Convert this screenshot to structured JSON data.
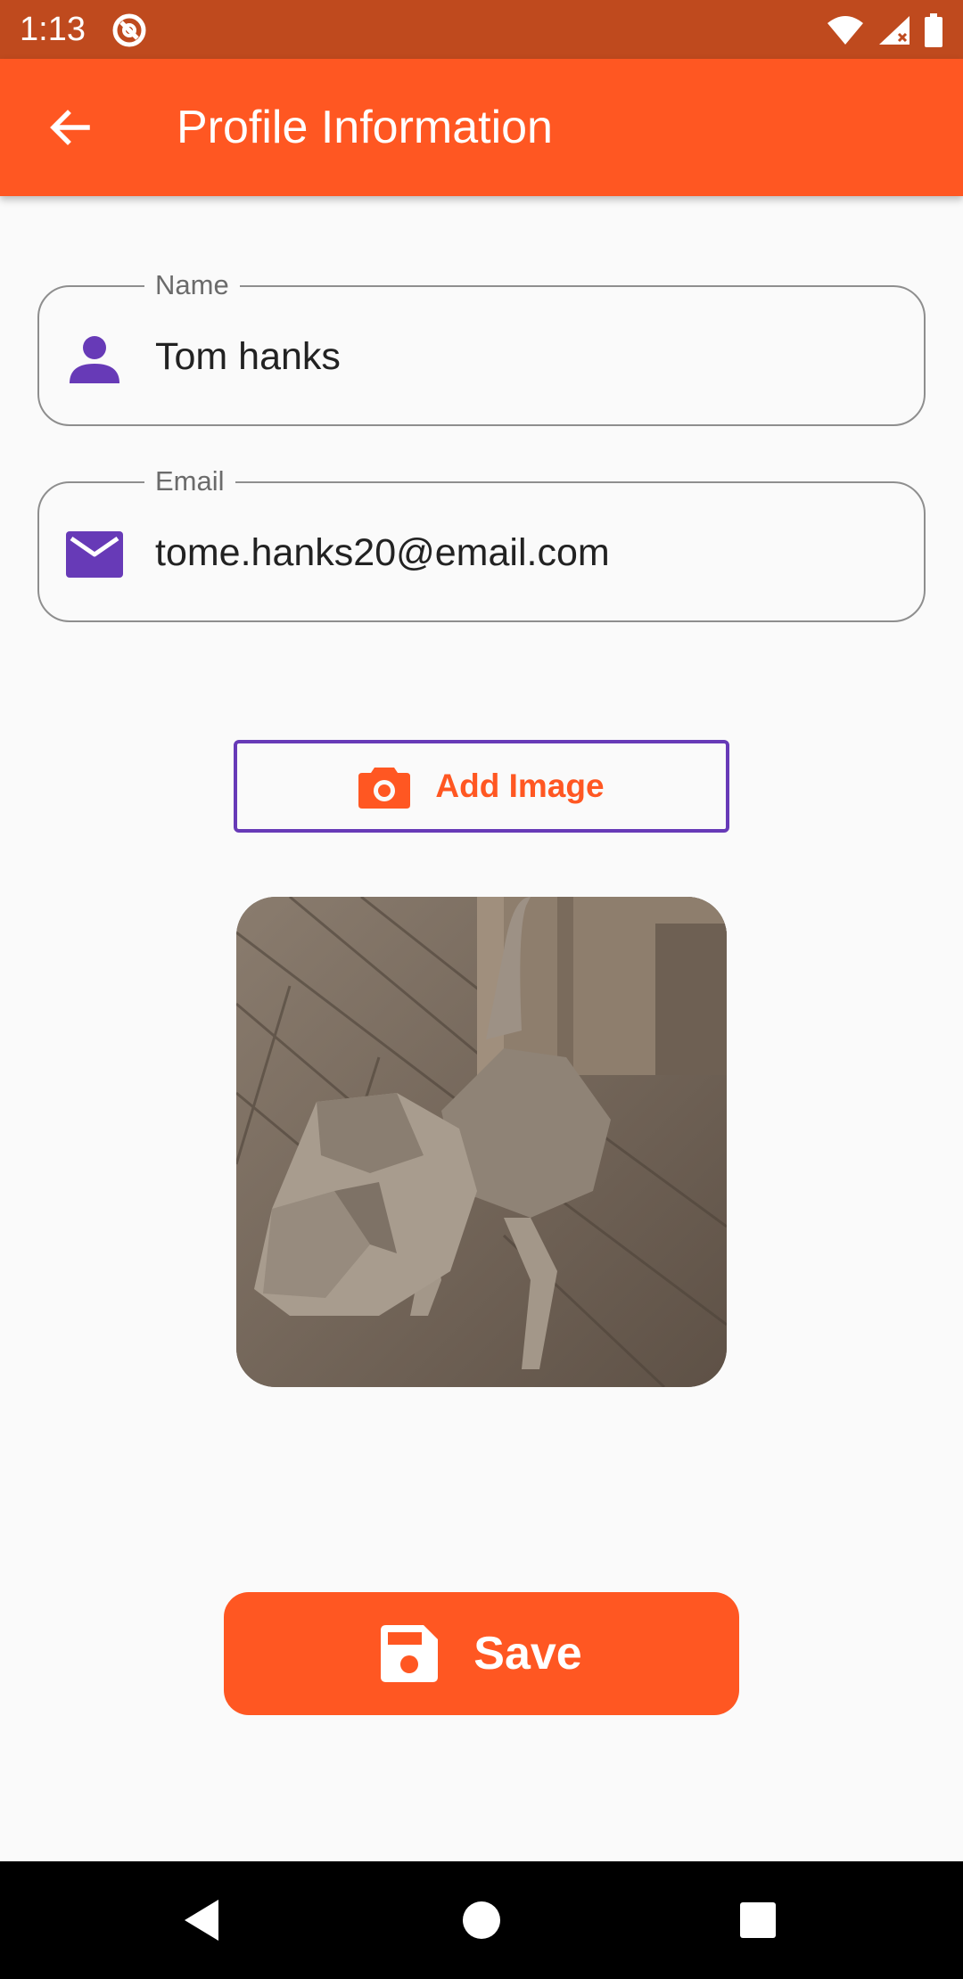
{
  "status_bar": {
    "time": "1:13",
    "icons": [
      "app-notification-icon",
      "wifi-icon",
      "signal-icon",
      "battery-icon"
    ]
  },
  "app_bar": {
    "title": "Profile Information",
    "back_icon": "arrow-back-icon"
  },
  "form": {
    "name": {
      "label": "Name",
      "value": "Tom hanks",
      "icon": "person-icon"
    },
    "email": {
      "label": "Email",
      "value": "tome.hanks20@email.com",
      "icon": "mail-icon"
    }
  },
  "add_image_button": {
    "label": "Add Image",
    "icon": "camera-icon"
  },
  "photo": {
    "icon": "dog-photo"
  },
  "save_button": {
    "label": "Save",
    "icon": "save-icon"
  },
  "nav_bar": {
    "items": [
      "back-nav-icon",
      "home-nav-icon",
      "recents-nav-icon"
    ]
  },
  "colors": {
    "status_bar": "#BF4A1E",
    "app_bar": "#FF5722",
    "accent": "#FF5722",
    "icon_purple": "#673AB7",
    "background": "#FAFAFA"
  }
}
